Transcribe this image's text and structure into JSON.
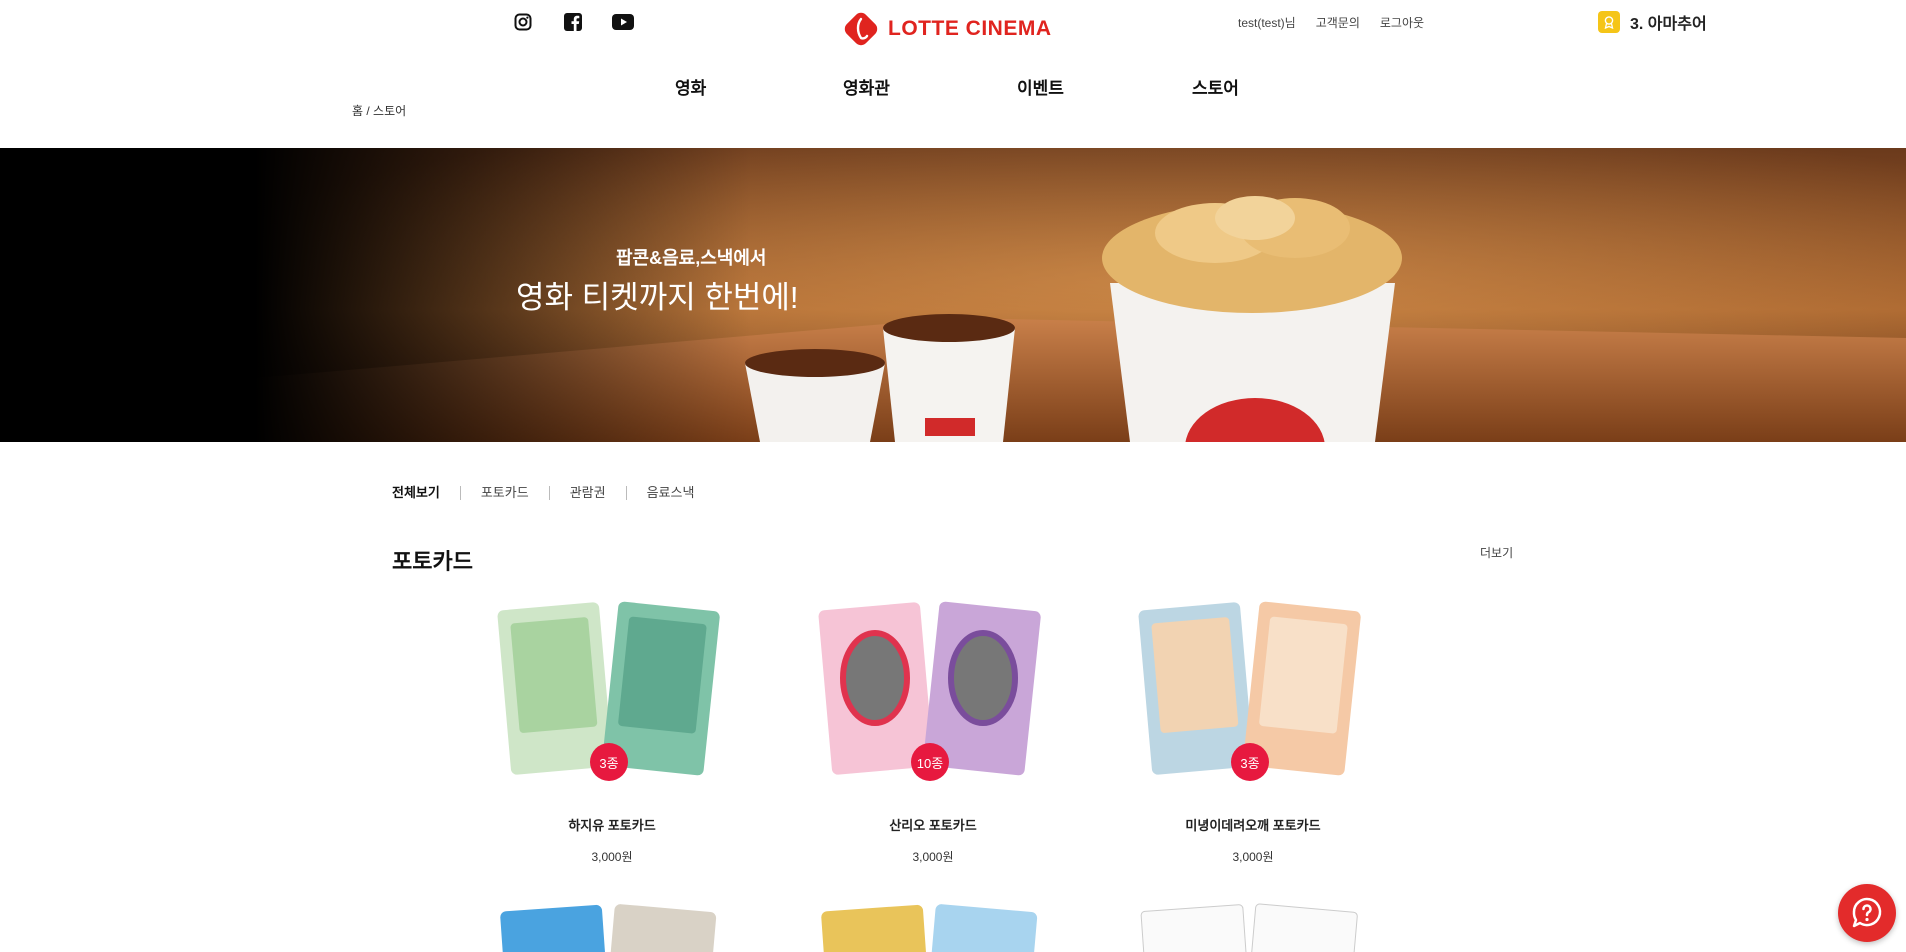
{
  "header": {
    "social": [
      "instagram-icon",
      "facebook-icon",
      "youtube-icon"
    ],
    "logo_text": "LOTTE CINEMA",
    "util_links": [
      "test(test)님",
      "고객문의",
      "로그아웃"
    ],
    "member_grade": "3. 아마추어"
  },
  "gnb": {
    "items": [
      "영화",
      "영화관",
      "이벤트",
      "스토어"
    ]
  },
  "breadcrumb": "홈 / 스토어",
  "banner": {
    "copy_small": "팝콘&음료,스낵에서",
    "copy_large": "영화 티켓까지 한번에!"
  },
  "tabs": [
    "전체보기",
    "포토카드",
    "관람권",
    "음료스낵"
  ],
  "section": {
    "title": "포토카드",
    "more": "더보기"
  },
  "products": [
    {
      "name": "하지유 포토카드",
      "price": "3,000원",
      "count": "3종"
    },
    {
      "name": "산리오 포토카드",
      "price": "3,000원",
      "count": "10종"
    },
    {
      "name": "미녕이데려오깨 포토카드",
      "price": "3,000원",
      "count": "3종"
    }
  ],
  "colors": {
    "brand": "#e0241f",
    "badge": "#e7193f",
    "help": "#e32b2b"
  }
}
